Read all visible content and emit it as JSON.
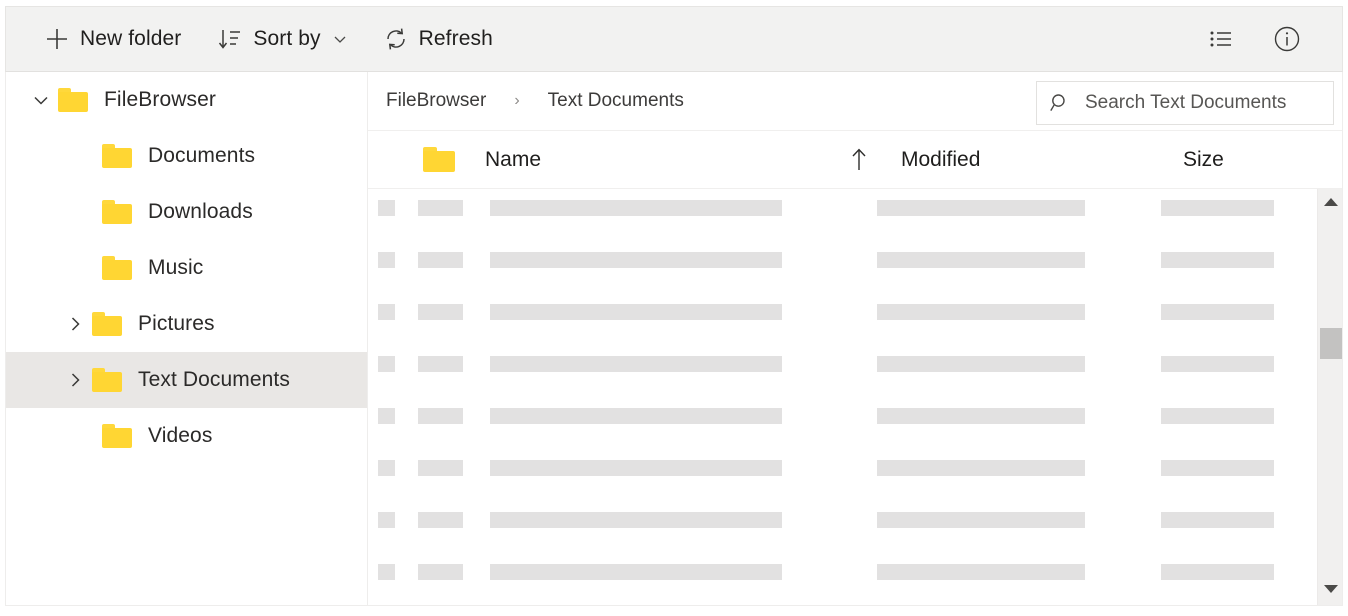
{
  "toolbar": {
    "new_folder_label": "New folder",
    "sort_by_label": "Sort by",
    "refresh_label": "Refresh",
    "icons": {
      "new_folder": "plus-icon",
      "sort_by": "sort-descending-icon",
      "sort_by_chevron": "chevron-down-icon",
      "refresh": "refresh-icon",
      "view_options": "list-view-icon",
      "details": "info-icon"
    },
    "background_color": "#f2f2f1"
  },
  "sidebar": {
    "items": [
      {
        "label": "FileBrowser",
        "level": 0,
        "twisty": "expanded",
        "selected": false,
        "icon": "folder-icon"
      },
      {
        "label": "Documents",
        "level": 1,
        "twisty": "none",
        "selected": false,
        "icon": "folder-icon"
      },
      {
        "label": "Downloads",
        "level": 1,
        "twisty": "none",
        "selected": false,
        "icon": "folder-icon"
      },
      {
        "label": "Music",
        "level": 1,
        "twisty": "none",
        "selected": false,
        "icon": "folder-icon"
      },
      {
        "label": "Pictures",
        "level": 1,
        "twisty": "collapsed",
        "selected": false,
        "icon": "folder-icon"
      },
      {
        "label": "Text Documents",
        "level": 1,
        "twisty": "collapsed",
        "selected": true,
        "icon": "folder-icon"
      },
      {
        "label": "Videos",
        "level": 1,
        "twisty": "none",
        "selected": false,
        "icon": "folder-icon"
      }
    ],
    "selected_background_color": "#e9e7e5",
    "folder_color": "#ffd633"
  },
  "breadcrumb": {
    "items": [
      "FileBrowser",
      "Text Documents"
    ],
    "separator": "›"
  },
  "search": {
    "placeholder": "Search Text Documents",
    "value": "",
    "icon": "search-icon"
  },
  "columns": {
    "name": "Name",
    "modified": "Modified",
    "size": "Size",
    "sort_indicator": "arrow-up-icon",
    "sort_column": "Modified",
    "sort_direction": "ascending",
    "folder_icon": "folder-icon"
  },
  "file_list": {
    "state": "loading",
    "placeholder_row_count": 8,
    "placeholder_color": "#e2e1e1",
    "rows": [
      {
        "check": "",
        "icon": "",
        "name": "",
        "modified": "",
        "size": ""
      },
      {
        "check": "",
        "icon": "",
        "name": "",
        "modified": "",
        "size": ""
      },
      {
        "check": "",
        "icon": "",
        "name": "",
        "modified": "",
        "size": ""
      },
      {
        "check": "",
        "icon": "",
        "name": "",
        "modified": "",
        "size": ""
      },
      {
        "check": "",
        "icon": "",
        "name": "",
        "modified": "",
        "size": ""
      },
      {
        "check": "",
        "icon": "",
        "name": "",
        "modified": "",
        "size": ""
      },
      {
        "check": "",
        "icon": "",
        "name": "",
        "modified": "",
        "size": ""
      },
      {
        "check": "",
        "icon": "",
        "name": "",
        "modified": "",
        "size": ""
      }
    ]
  },
  "scrollbar": {
    "up_arrow": "triangle-up-icon",
    "down_arrow": "triangle-down-icon",
    "thumb_color": "#c3c2c1",
    "track_color": "#f1f0ef"
  }
}
